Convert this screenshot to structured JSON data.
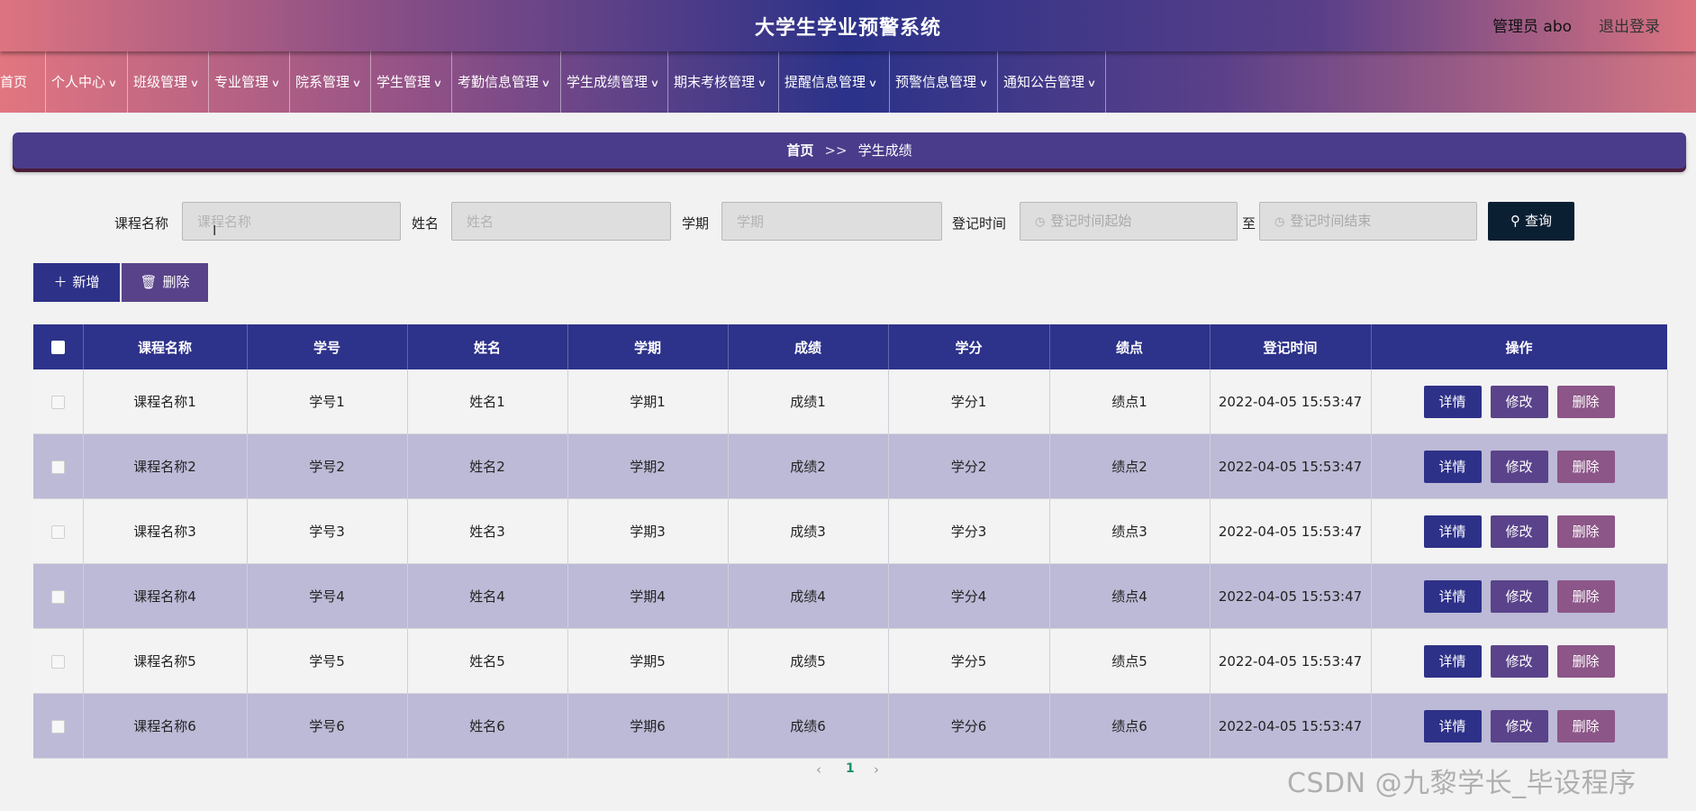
{
  "header": {
    "app_title": "大学生学业预警系统",
    "admin_label": "管理员 abo",
    "logout_label": "退出登录"
  },
  "nav": {
    "items": [
      {
        "label": "首页"
      },
      {
        "label": "个人中心"
      },
      {
        "label": "班级管理"
      },
      {
        "label": "专业管理"
      },
      {
        "label": "院系管理"
      },
      {
        "label": "学生管理"
      },
      {
        "label": "考勤信息管理"
      },
      {
        "label": "学生成绩管理"
      },
      {
        "label": "期末考核管理"
      },
      {
        "label": "提醒信息管理"
      },
      {
        "label": "预警信息管理"
      },
      {
        "label": "通知公告管理"
      }
    ]
  },
  "breadcrumb": {
    "home": "首页",
    "separator": ">>",
    "current": "学生成绩"
  },
  "search": {
    "course_label": "课程名称",
    "course_placeholder": "课程名称",
    "name_label": "姓名",
    "name_placeholder": "姓名",
    "term_label": "学期",
    "term_placeholder": "学期",
    "time_label": "登记时间",
    "time_start_placeholder": "登记时间起始",
    "to_label": "至",
    "time_end_placeholder": "登记时间结束",
    "query_button": "查询"
  },
  "actions": {
    "add_button": "新增",
    "delete_button": "删除"
  },
  "table": {
    "headers": [
      "课程名称",
      "学号",
      "姓名",
      "学期",
      "成绩",
      "学分",
      "绩点",
      "登记时间",
      "操作"
    ],
    "action_labels": {
      "detail": "详情",
      "edit": "修改",
      "delete": "删除"
    },
    "rows": [
      {
        "course": "课程名称1",
        "student_no": "学号1",
        "name": "姓名1",
        "term": "学期1",
        "score": "成绩1",
        "credit": "学分1",
        "gpa": "绩点1",
        "time": "2022-04-05 15:53:47"
      },
      {
        "course": "课程名称2",
        "student_no": "学号2",
        "name": "姓名2",
        "term": "学期2",
        "score": "成绩2",
        "credit": "学分2",
        "gpa": "绩点2",
        "time": "2022-04-05 15:53:47"
      },
      {
        "course": "课程名称3",
        "student_no": "学号3",
        "name": "姓名3",
        "term": "学期3",
        "score": "成绩3",
        "credit": "学分3",
        "gpa": "绩点3",
        "time": "2022-04-05 15:53:47"
      },
      {
        "course": "课程名称4",
        "student_no": "学号4",
        "name": "姓名4",
        "term": "学期4",
        "score": "成绩4",
        "credit": "学分4",
        "gpa": "绩点4",
        "time": "2022-04-05 15:53:47"
      },
      {
        "course": "课程名称5",
        "student_no": "学号5",
        "name": "姓名5",
        "term": "学期5",
        "score": "成绩5",
        "credit": "学分5",
        "gpa": "绩点5",
        "time": "2022-04-05 15:53:47"
      },
      {
        "course": "课程名称6",
        "student_no": "学号6",
        "name": "姓名6",
        "term": "学期6",
        "score": "成绩6",
        "credit": "学分6",
        "gpa": "绩点6",
        "time": "2022-04-05 15:53:47"
      }
    ]
  },
  "pagination": {
    "prev": "‹",
    "current_page": "1",
    "next": "›"
  },
  "colors": {
    "primary": "#2e3188",
    "secondary": "#5a438a",
    "danger": "#8c5688",
    "query": "#0b1f33",
    "row_alt": "#bcbad6"
  },
  "watermark": "CSDN @九黎学长_毕设程序"
}
